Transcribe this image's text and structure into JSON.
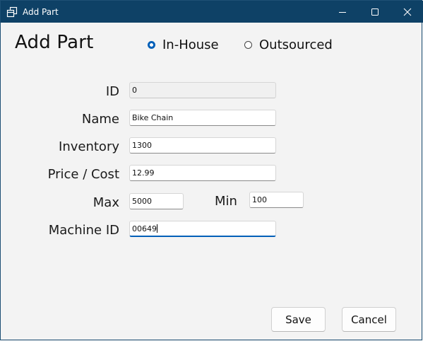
{
  "window": {
    "title": "Add Part",
    "icon": "window-app-icon"
  },
  "form": {
    "heading": "Add Part",
    "source_options": [
      {
        "label": "In-House",
        "selected": true
      },
      {
        "label": "Outsourced",
        "selected": false
      }
    ],
    "fields": {
      "id": {
        "label": "ID",
        "value": "0",
        "enabled": false
      },
      "name": {
        "label": "Name",
        "value": "Bike Chain"
      },
      "inventory": {
        "label": "Inventory",
        "value": "1300"
      },
      "price": {
        "label": "Price / Cost",
        "value": "12.99"
      },
      "max": {
        "label": "Max",
        "value": "5000"
      },
      "min": {
        "label": "Min",
        "value": "100"
      },
      "machine_id": {
        "label": "Machine ID",
        "value": "00649",
        "focused": true
      }
    }
  },
  "buttons": {
    "save": "Save",
    "cancel": "Cancel"
  },
  "colors": {
    "titlebar": "#0e4166",
    "accent": "#005fb8",
    "background": "#f3f3f3"
  }
}
